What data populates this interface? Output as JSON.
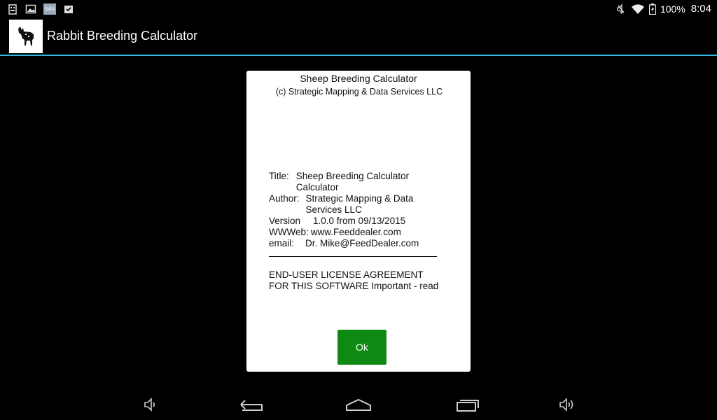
{
  "status_bar": {
    "battery_percent": "100%",
    "time": "8:04",
    "icons": [
      "usb-debug-icon",
      "image-icon",
      "notification-badge-icon",
      "clipboard-check-icon",
      "mute-icon",
      "wifi-icon",
      "battery-icon"
    ],
    "badge_text": "b4s"
  },
  "action_bar": {
    "title": "Rabbit Breeding Calculator",
    "accent_color": "#33b5e5"
  },
  "dialog": {
    "title": "Sheep Breeding Calculator",
    "copyright": "(c) Strategic Mapping & Data Services LLC",
    "fields": [
      {
        "key": "Title:",
        "value": "Sheep Breeding Calculator Calculator"
      },
      {
        "key": "Author:",
        "value": "Strategic Mapping & Data Services LLC"
      },
      {
        "key": "Version",
        "value": "1.0.0 from 09/13/2015"
      },
      {
        "key": "WWWeb:",
        "value": "www.Feeddealer.com"
      },
      {
        "key": "email:",
        "value": "Dr. Mike@FeedDealer.com"
      }
    ],
    "eula_text": "END-USER LICENSE AGREEMENT FOR THIS SOFTWARE Important - read",
    "ok_label": "Ok",
    "ok_color": "#0e8a12"
  },
  "nav_bar": {
    "buttons": [
      "volume-down-icon",
      "back-icon",
      "home-icon",
      "recent-apps-icon",
      "volume-up-icon"
    ]
  }
}
